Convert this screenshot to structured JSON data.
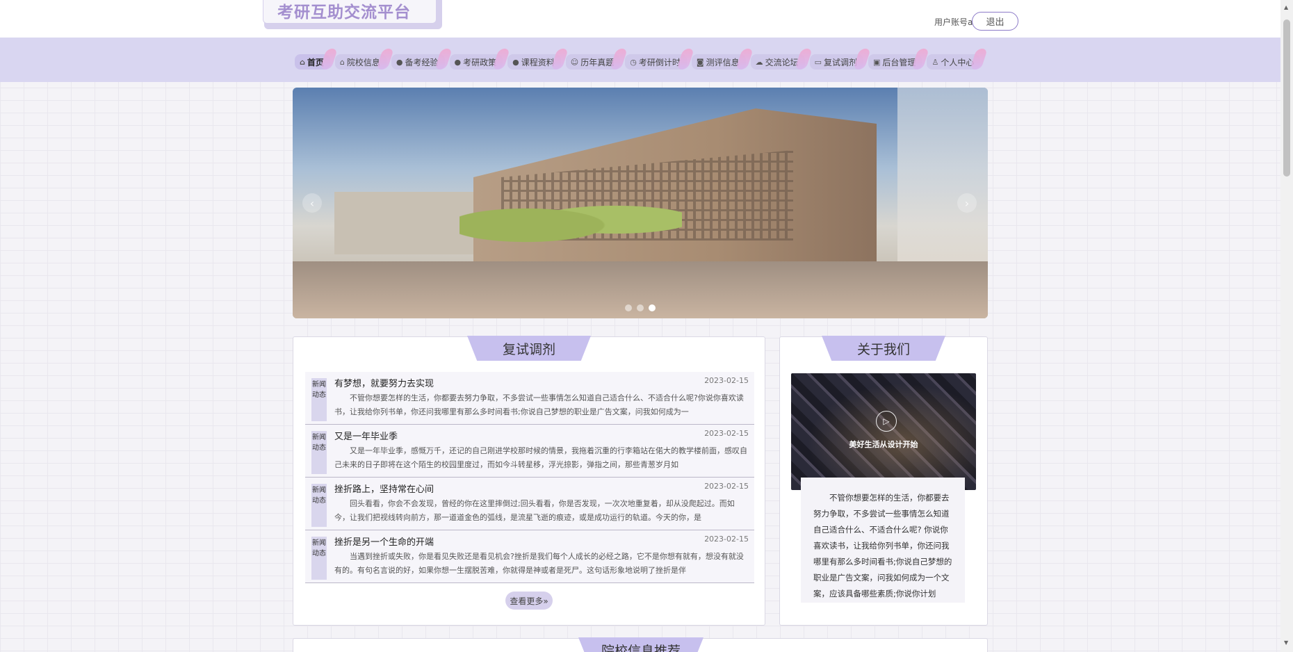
{
  "header": {
    "logo": "考研互助交流平台",
    "user_label": "用户账号a",
    "logout": "退出"
  },
  "nav": [
    {
      "label": "首页",
      "icon": "home-icon",
      "glyph": "⌂"
    },
    {
      "label": "院校信息",
      "icon": "school-icon",
      "glyph": "⌂"
    },
    {
      "label": "备考经验",
      "icon": "info-icon",
      "glyph": "●"
    },
    {
      "label": "考研政策",
      "icon": "question-icon",
      "glyph": "●"
    },
    {
      "label": "课程资料",
      "icon": "info-circle-icon",
      "glyph": "●"
    },
    {
      "label": "历年真题",
      "icon": "smile-icon",
      "glyph": "☺"
    },
    {
      "label": "考研倒计时",
      "icon": "check-circle-icon",
      "glyph": "◷"
    },
    {
      "label": "测评信息",
      "icon": "camera-icon",
      "glyph": "◙"
    },
    {
      "label": "交流论坛",
      "icon": "cloud-icon",
      "glyph": "☁"
    },
    {
      "label": "复试调剂",
      "icon": "video-icon",
      "glyph": "▭"
    },
    {
      "label": "后台管理",
      "icon": "calendar-icon",
      "glyph": "▣"
    },
    {
      "label": "个人中心",
      "icon": "user-icon",
      "glyph": "♙"
    }
  ],
  "banner": {
    "prev": "‹",
    "next": "›",
    "slides": 3,
    "active_slide": 3
  },
  "news": {
    "title": "复试调剂",
    "tag": "新闻动态",
    "more": "查看更多»",
    "items": [
      {
        "title": "有梦想，就要努力去实现",
        "date": "2023-02-15",
        "desc": "不管你想要怎样的生活，你都要去努力争取，不多尝试一些事情怎么知道自己适合什么、不适合什么呢?你说你喜欢读书，让我给你列书单，你还问我哪里有那么多时间看书;你说自己梦想的职业是广告文案，问我如何成为一"
      },
      {
        "title": "又是一年毕业季",
        "date": "2023-02-15",
        "desc": "又是一年毕业季，感慨万千，还记的自己刚进学校那时候的情景，我拖着沉重的行李箱站在偌大的教学楼前面，感叹自己未来的日子即将在这个陌生的校园里度过，而如今斗转星移，浮光掠影，弹指之间，那些青葱岁月如"
      },
      {
        "title": "挫折路上，坚持常在心间",
        "date": "2023-02-15",
        "desc": "回头看看，你会不会发现，曾经的你在这里摔倒过;回头看看，你是否发现，一次次地重复着，却从没爬起过。而如今，让我们把视线转向前方，那一道道金色的弧线，是流星飞逝的痕迹，或是成功运行的轨道。今天的你，是"
      },
      {
        "title": "挫折是另一个生命的开端",
        "date": "2023-02-15",
        "desc": "当遇到挫折或失败，你是看见失败还是看见机会?挫折是我们每个人成长的必经之路，它不是你想有就有，想没有就没有的。有句名言说的好，如果你想一生摆脱苦难，你就得是神或者是死尸。这句话形象地说明了挫折是伴"
      }
    ]
  },
  "about": {
    "title": "关于我们",
    "caption": "美好生活从设计开始",
    "text": "不管你想要怎样的生活，你都要去努力争取，不多尝试一些事情怎么知道自己适合什么、不适合什么呢? 你说你喜欢读书，让我给你列书单，你还问我哪里有那么多时间看书;你说自己梦想的职业是广告文案，问我如何成为一个文案，应该具备哪些素质;你说你计划"
  },
  "next_section": {
    "title": "院校信息推荐"
  }
}
